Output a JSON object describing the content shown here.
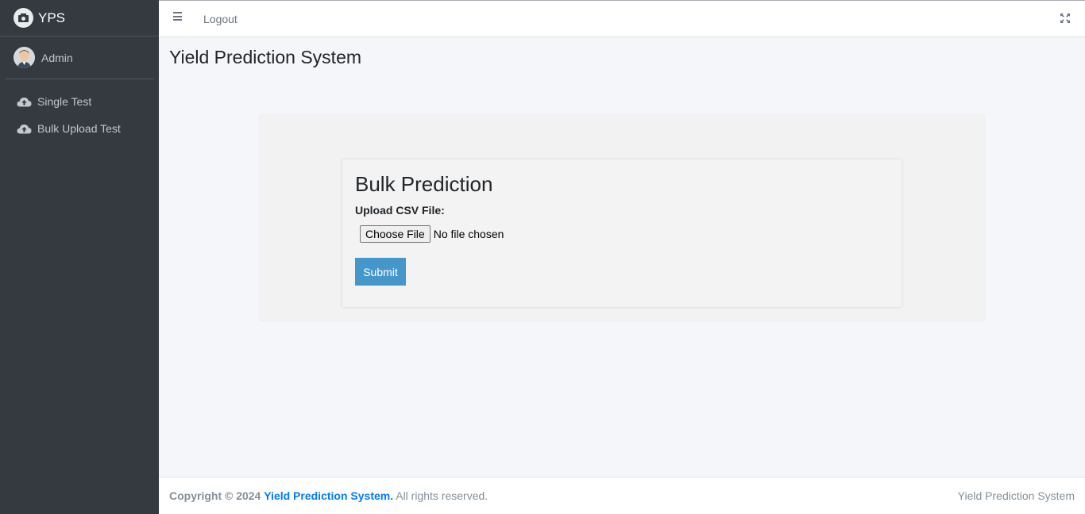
{
  "sidebar": {
    "brand": "YPS",
    "user": "Admin",
    "items": [
      {
        "label": "Single Test",
        "icon": "cloud-upload-icon"
      },
      {
        "label": "Bulk Upload Test",
        "icon": "cloud-upload-icon"
      }
    ]
  },
  "topbar": {
    "logout": "Logout"
  },
  "page": {
    "title": "Yield Prediction System"
  },
  "form": {
    "title": "Bulk Prediction",
    "label": "Upload CSV File:",
    "choose_label": "Choose File",
    "file_status": "No file chosen",
    "submit_label": "Submit"
  },
  "footer": {
    "copyright_prefix": "Copyright © 2024",
    "copyright_link": "Yield Prediction System.",
    "copyright_suffix": "All rights reserved.",
    "right_text": "Yield Prediction System"
  },
  "colors": {
    "sidebar_bg": "#343a40",
    "accent": "#4596c9",
    "link": "#007bff"
  }
}
